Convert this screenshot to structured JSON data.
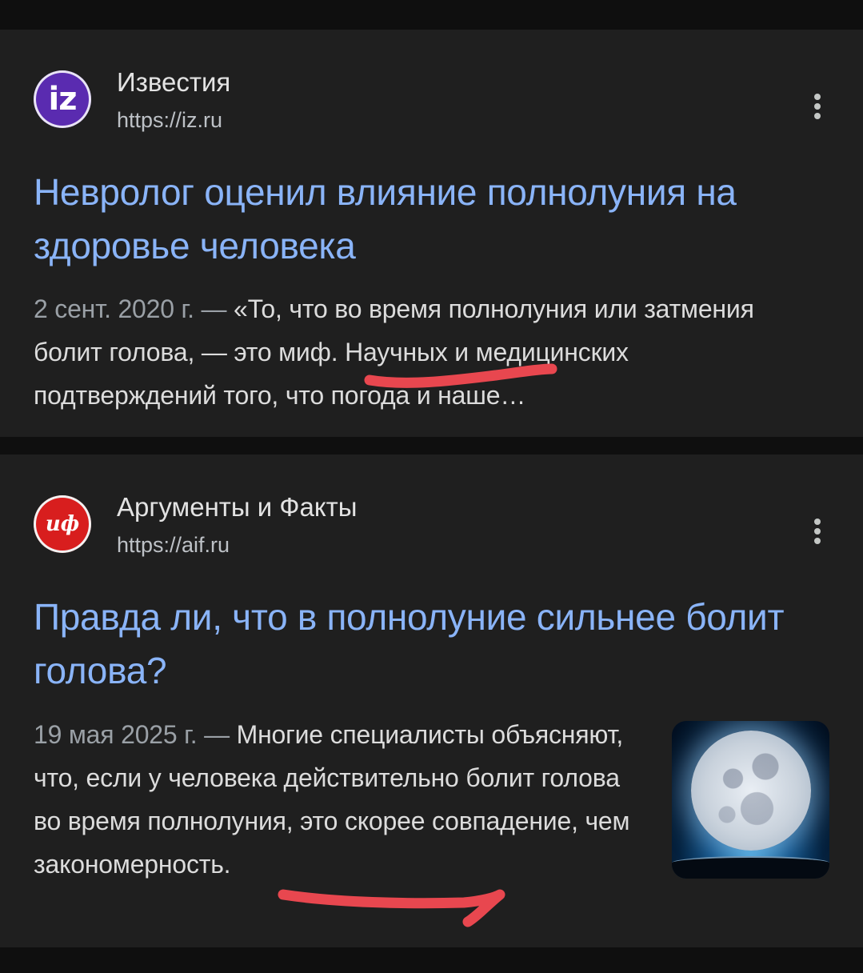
{
  "results": [
    {
      "logo_text": "iz",
      "logo_icon": "izvestia-logo-icon",
      "source_name": "Известия",
      "url": "https://iz.ru",
      "title": "Невролог оценил влияние полнолуния на здоровье человека",
      "date": "2 сент. 2020 г. —",
      "snippet": " «То, что во время полнолуния или затмения болит голова, — это миф. Научных и медицинских подтверждений того, что погода и наше…"
    },
    {
      "logo_text": "иф",
      "logo_icon": "aif-logo-icon",
      "source_name": "Аргументы и Факты",
      "url": "https://aif.ru",
      "title": "Правда ли, что в полнолуние сильнее болит голова?",
      "date": "19 мая 2025 г. —",
      "snippet": " Многие специалисты объясняют, что, если у человека действительно болит голова во время полнолуния, это скорее совпадение, чем закономерность.",
      "thumbnail": "full-moon-image"
    }
  ],
  "colors": {
    "background": "#0f0f0f",
    "card": "#1f1f1f",
    "title": "#8ab4f8",
    "text": "#dcdcdc",
    "muted": "#9aa0a6",
    "annotation": "#e8474f"
  }
}
